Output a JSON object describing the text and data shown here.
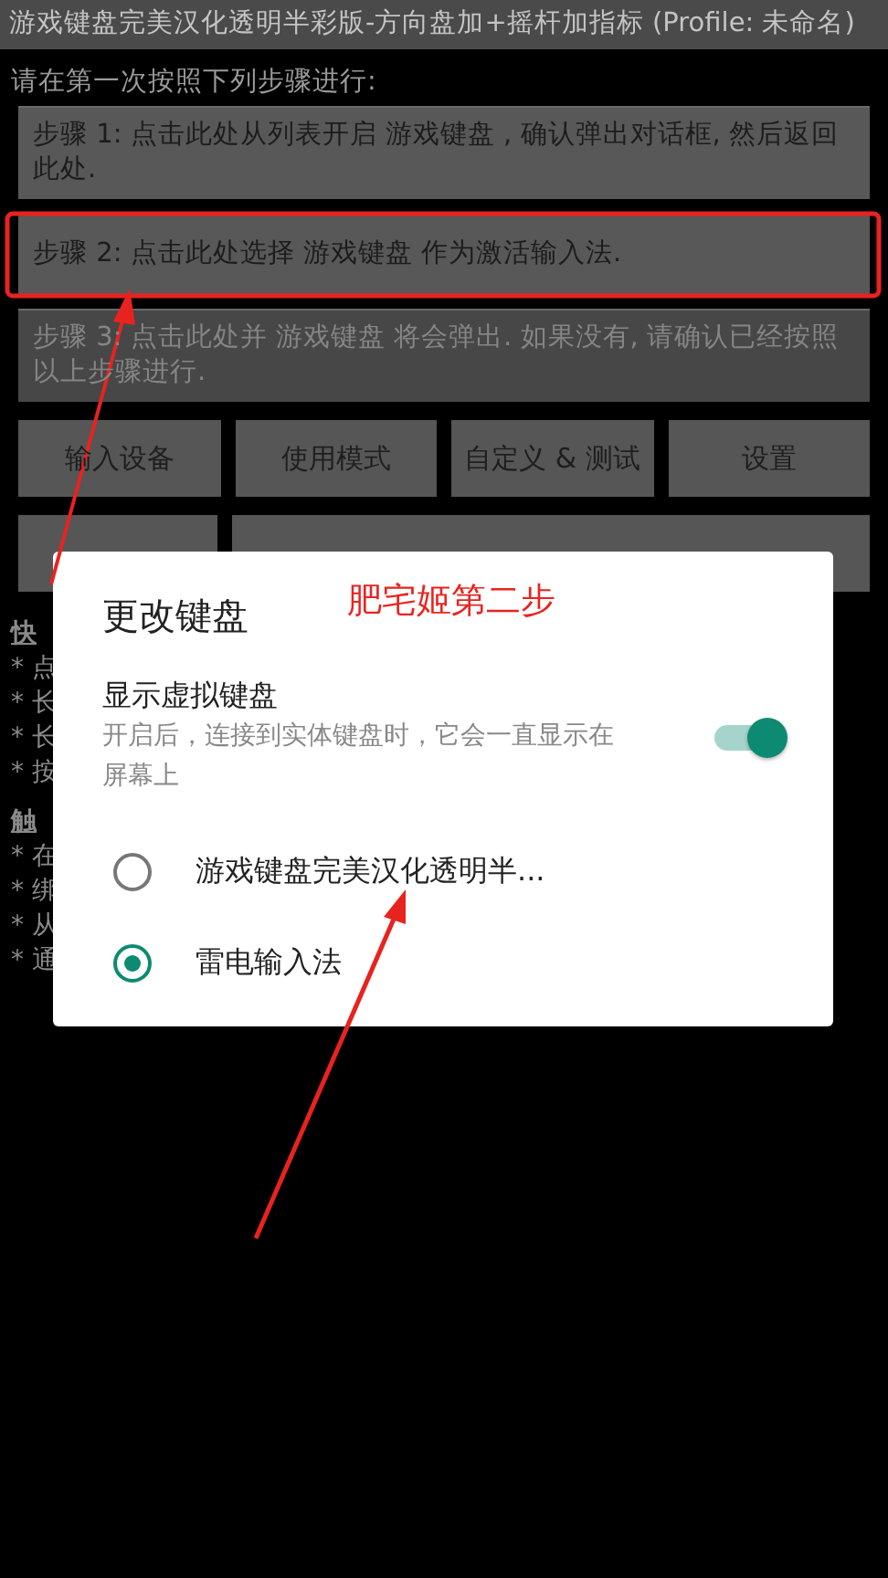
{
  "title_bar": {
    "title": "游戏键盘完美汉化透明半彩版-方向盘加+摇杆加指标 (Profile: 未命名)"
  },
  "instruction": "请在第一次按照下列步骤进行:",
  "steps": [
    {
      "label": "步骤 1: 点击此处从列表开启 游戏键盘 , 确认弹出对话框, 然后返回此处.",
      "disabled": false
    },
    {
      "label": "步骤 2: 点击此处选择 游戏键盘 作为激活输入法.",
      "disabled": false
    },
    {
      "label": "步骤 3: 点击此处并 游戏键盘 将会弹出. 如果没有, 请确认已经按照以上步骤进行.",
      "disabled": true
    }
  ],
  "buttons": [
    "输入设备",
    "使用模式",
    "自定义 & 测试",
    "设置"
  ],
  "covered_buttons": [
    {
      "kind": "narrow"
    },
    {
      "kind": "wide"
    }
  ],
  "help_lines": [
    {
      "text": "快",
      "kind": "heading"
    },
    {
      "text": "* 点",
      "kind": "item"
    },
    {
      "text": "* 长",
      "kind": "item"
    },
    {
      "text": "* 长",
      "kind": "item"
    },
    {
      "text": "* 按",
      "kind": "item"
    },
    {
      "text": "触",
      "kind": "heading"
    },
    {
      "text": "* 在",
      "kind": "item"
    },
    {
      "text": "* 绑",
      "kind": "item"
    },
    {
      "text": "* 从",
      "kind": "item"
    },
    {
      "text": "* 通",
      "kind": "item"
    }
  ],
  "dialog": {
    "title": "更改键盘",
    "toggle": {
      "label": "显示虚拟键盘",
      "description": "开启后，连接到实体键盘时，它会一直显示在屏幕上",
      "on": true
    },
    "options": [
      {
        "label": "游戏键盘完美汉化透明半...",
        "selected": false
      },
      {
        "label": "雷电输入法",
        "selected": true
      }
    ]
  },
  "annotation": {
    "text": "肥宅姬第二步"
  }
}
